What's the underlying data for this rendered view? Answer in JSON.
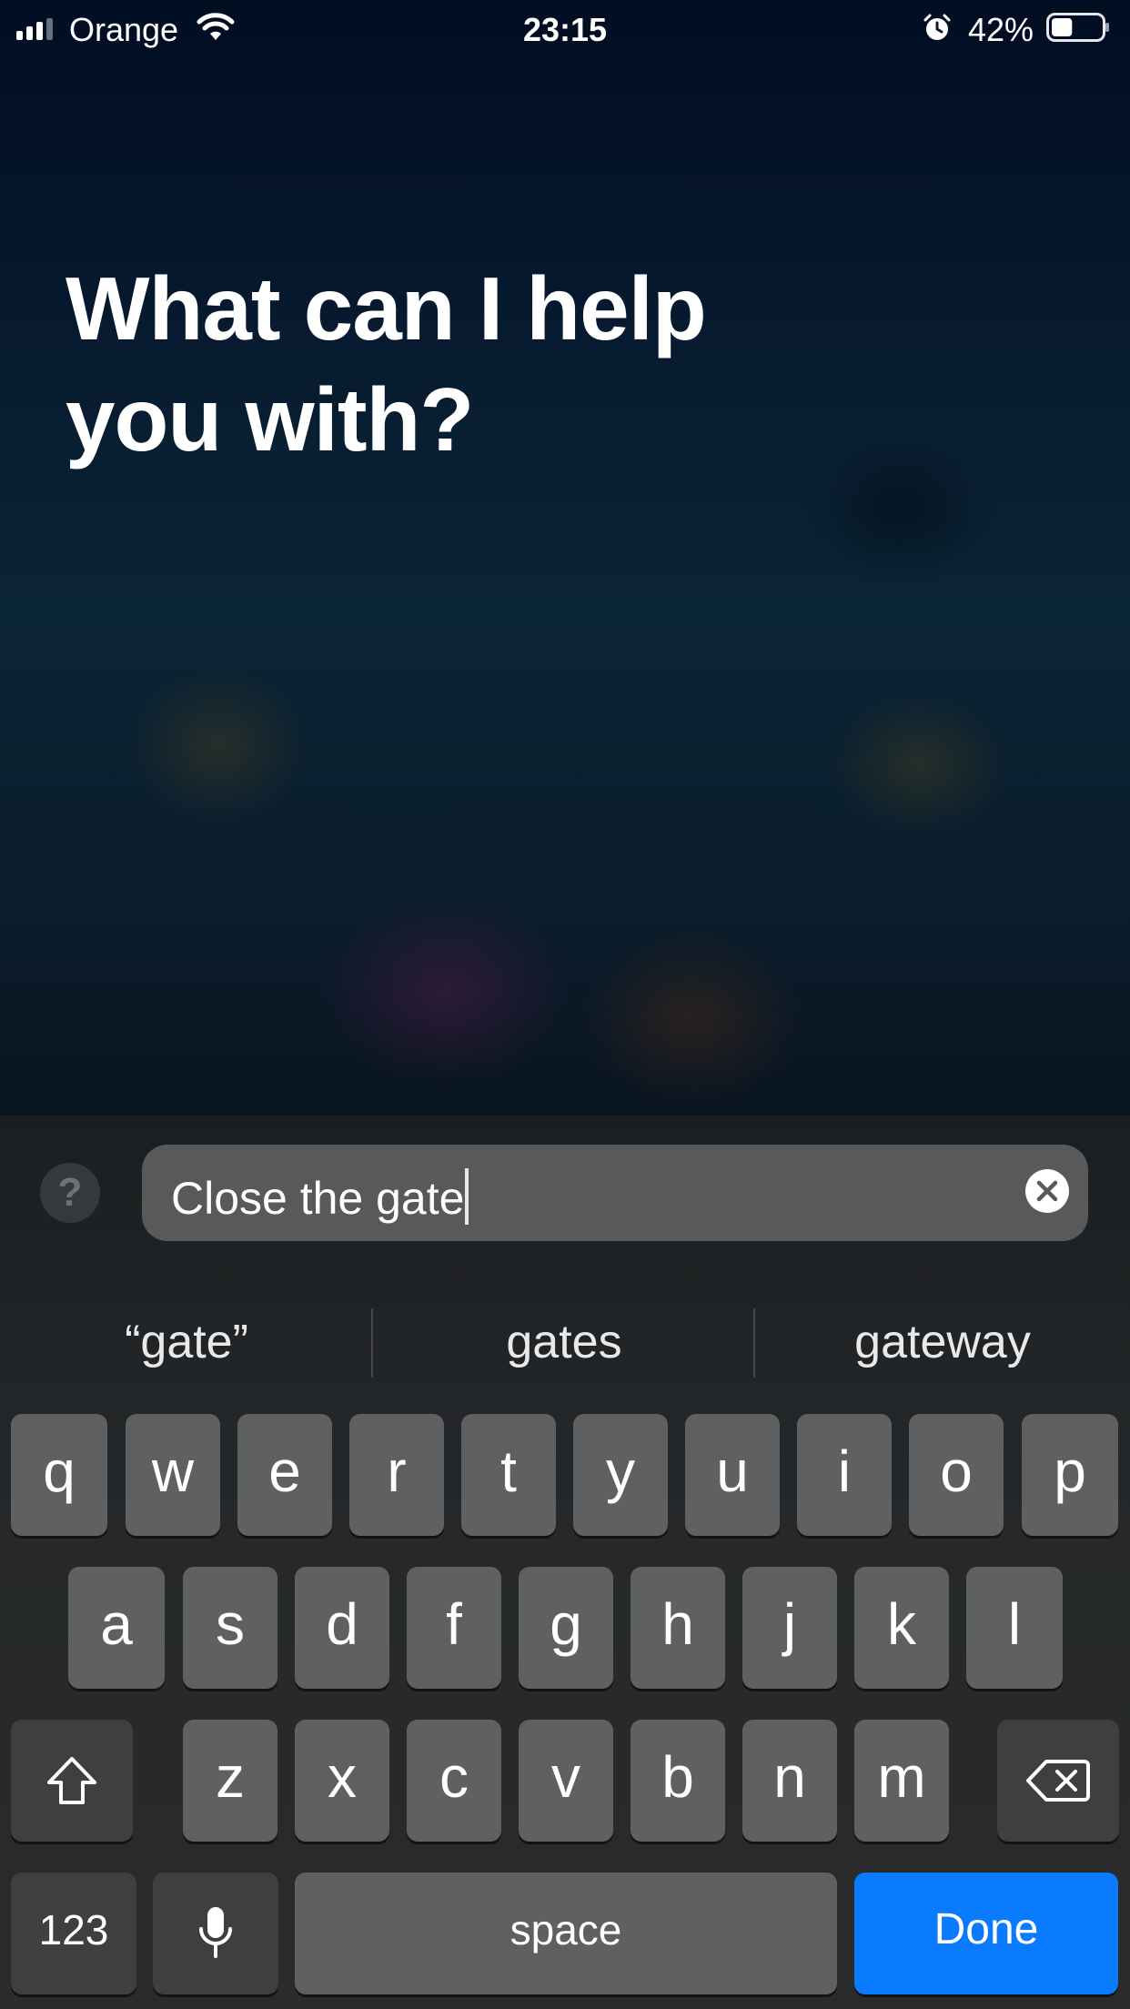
{
  "status_bar": {
    "carrier": "Orange",
    "time": "23:15",
    "battery_percent": "42%",
    "battery_level": 0.42,
    "icons": [
      "signal-icon",
      "wifi-icon",
      "alarm-icon",
      "battery-icon"
    ]
  },
  "siri": {
    "prompt": "What can I help you with?"
  },
  "input_bar": {
    "help_label": "?",
    "text": "Close the gate",
    "clear_icon": "clear-icon"
  },
  "suggestions": [
    "“gate”",
    "gates",
    "gateway"
  ],
  "keyboard": {
    "row1": [
      "q",
      "w",
      "e",
      "r",
      "t",
      "y",
      "u",
      "i",
      "o",
      "p"
    ],
    "row2": [
      "a",
      "s",
      "d",
      "f",
      "g",
      "h",
      "j",
      "k",
      "l"
    ],
    "row3": [
      "z",
      "x",
      "c",
      "v",
      "b",
      "n",
      "m"
    ],
    "shift_icon": "shift-icon",
    "backspace_icon": "backspace-icon",
    "numbers_label": "123",
    "mic_icon": "microphone-icon",
    "space_label": "space",
    "done_label": "Done"
  },
  "colors": {
    "accent": "#0a7bff",
    "key": "#5e6061",
    "key_dark": "#3d3f40"
  }
}
